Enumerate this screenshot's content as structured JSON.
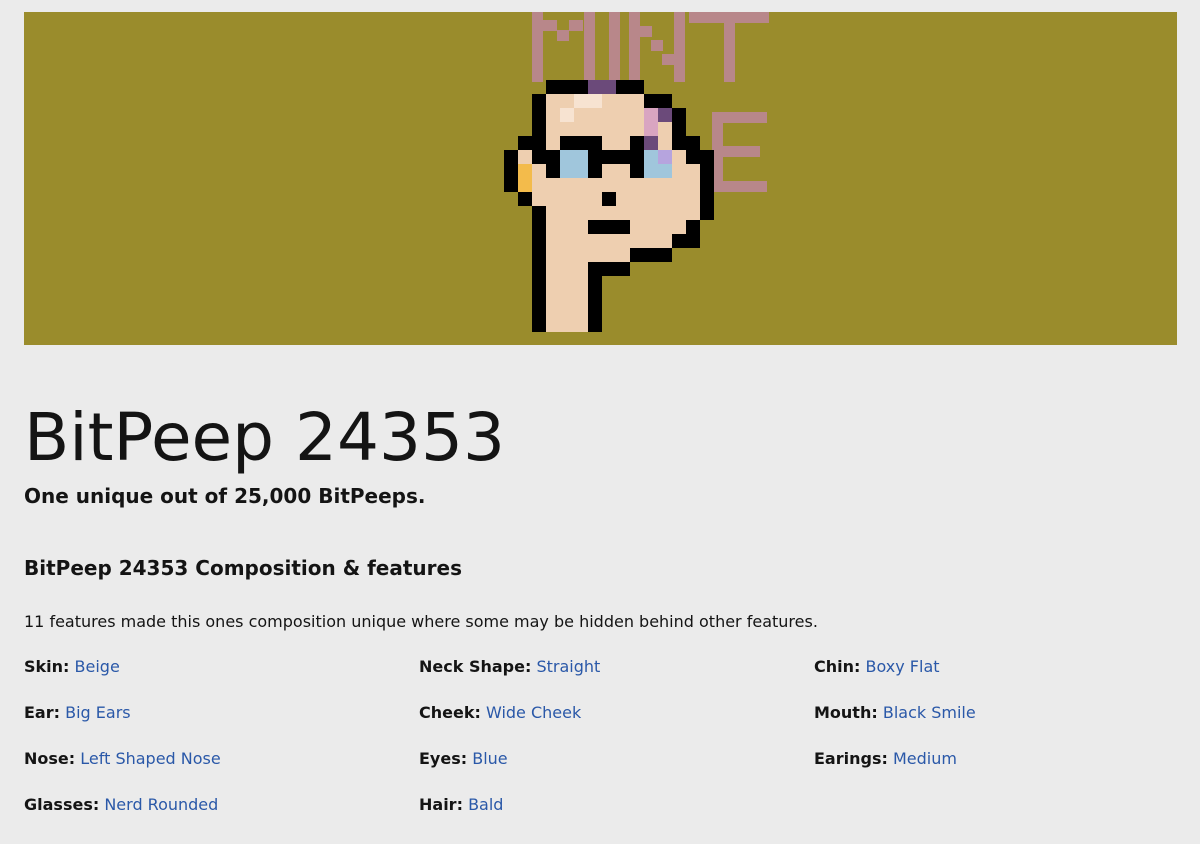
{
  "page": {
    "title": "BitPeep 24353",
    "subtitle": "One unique out of 25,000 BitPeeps.",
    "section_heading": "BitPeep 24353 Composition & features",
    "description": "11 features made this ones composition unique where some may be hidden behind other features."
  },
  "banner": {
    "background_color": "#9a8c2c",
    "watermark_text": "MINT ME",
    "watermark_color": "#b8878a"
  },
  "colors": {
    "link": "#2a58a8",
    "skin": "#eecfb0",
    "lens": "#a0c6dc",
    "earring": "#f3bb4b",
    "outline": "#000000",
    "hair_purple": "#6b4a7a"
  },
  "features": [
    {
      "label": "Skin:",
      "value": "Beige"
    },
    {
      "label": "Neck Shape:",
      "value": "Straight"
    },
    {
      "label": "Chin:",
      "value": "Boxy Flat"
    },
    {
      "label": "Ear:",
      "value": "Big Ears"
    },
    {
      "label": "Cheek:",
      "value": "Wide Cheek"
    },
    {
      "label": "Mouth:",
      "value": "Black Smile"
    },
    {
      "label": "Nose:",
      "value": "Left Shaped Nose"
    },
    {
      "label": "Eyes:",
      "value": "Blue"
    },
    {
      "label": "Earings:",
      "value": "Medium"
    },
    {
      "label": "Glasses:",
      "value": "Nerd Rounded"
    },
    {
      "label": "Hair:",
      "value": "Bald"
    }
  ]
}
